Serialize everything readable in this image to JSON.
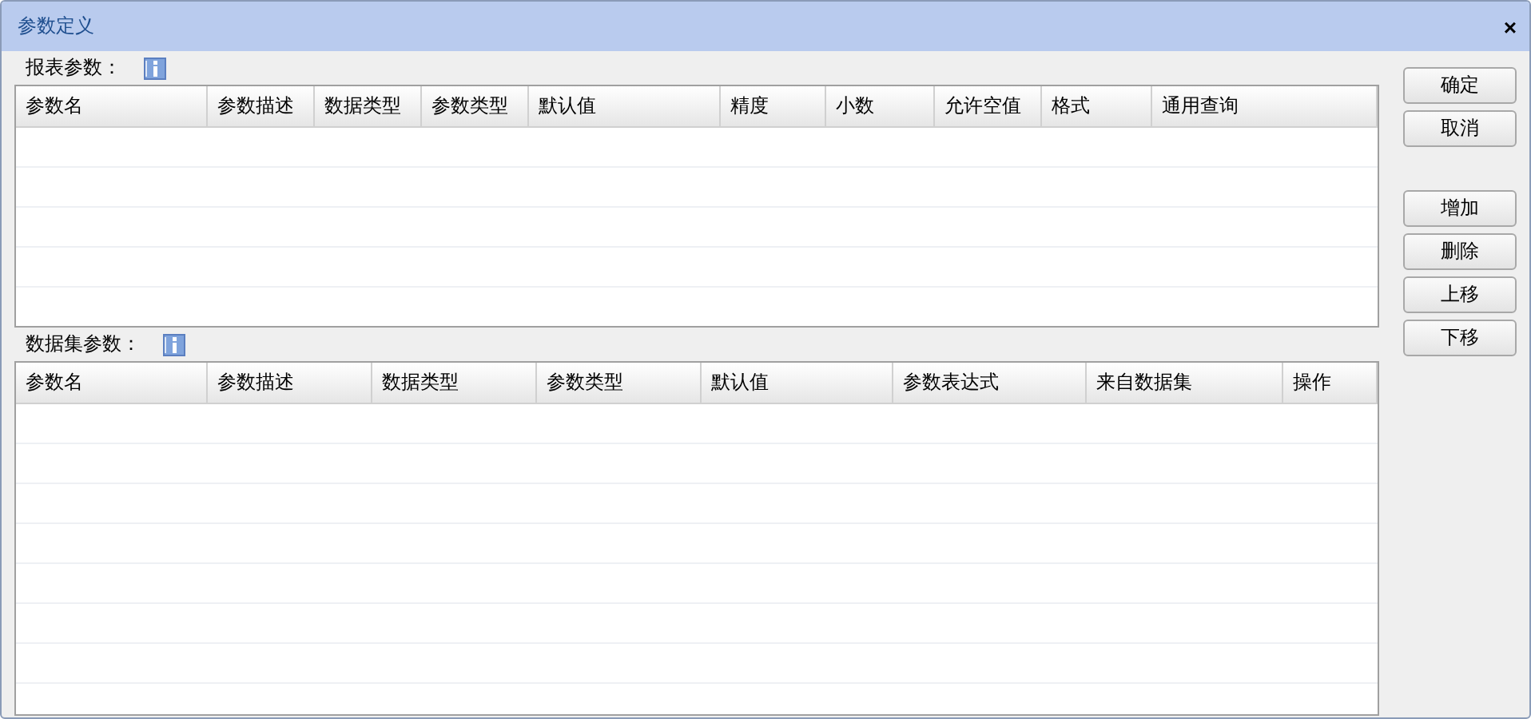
{
  "window": {
    "title": "参数定义",
    "close": "×"
  },
  "report_params": {
    "label": "报表参数：",
    "columns": [
      "参数名",
      "参数描述",
      "数据类型",
      "参数类型",
      "默认值",
      "精度",
      "小数",
      "允许空值",
      "格式",
      "通用查询"
    ]
  },
  "dataset_params": {
    "label": "数据集参数：",
    "columns": [
      "参数名",
      "参数描述",
      "数据类型",
      "参数类型",
      "默认值",
      "参数表达式",
      "来自数据集",
      "操作"
    ]
  },
  "dialog_buttons": [
    "确定",
    "取消"
  ],
  "edit_buttons": [
    "增加",
    "删除",
    "上移",
    "下移"
  ]
}
